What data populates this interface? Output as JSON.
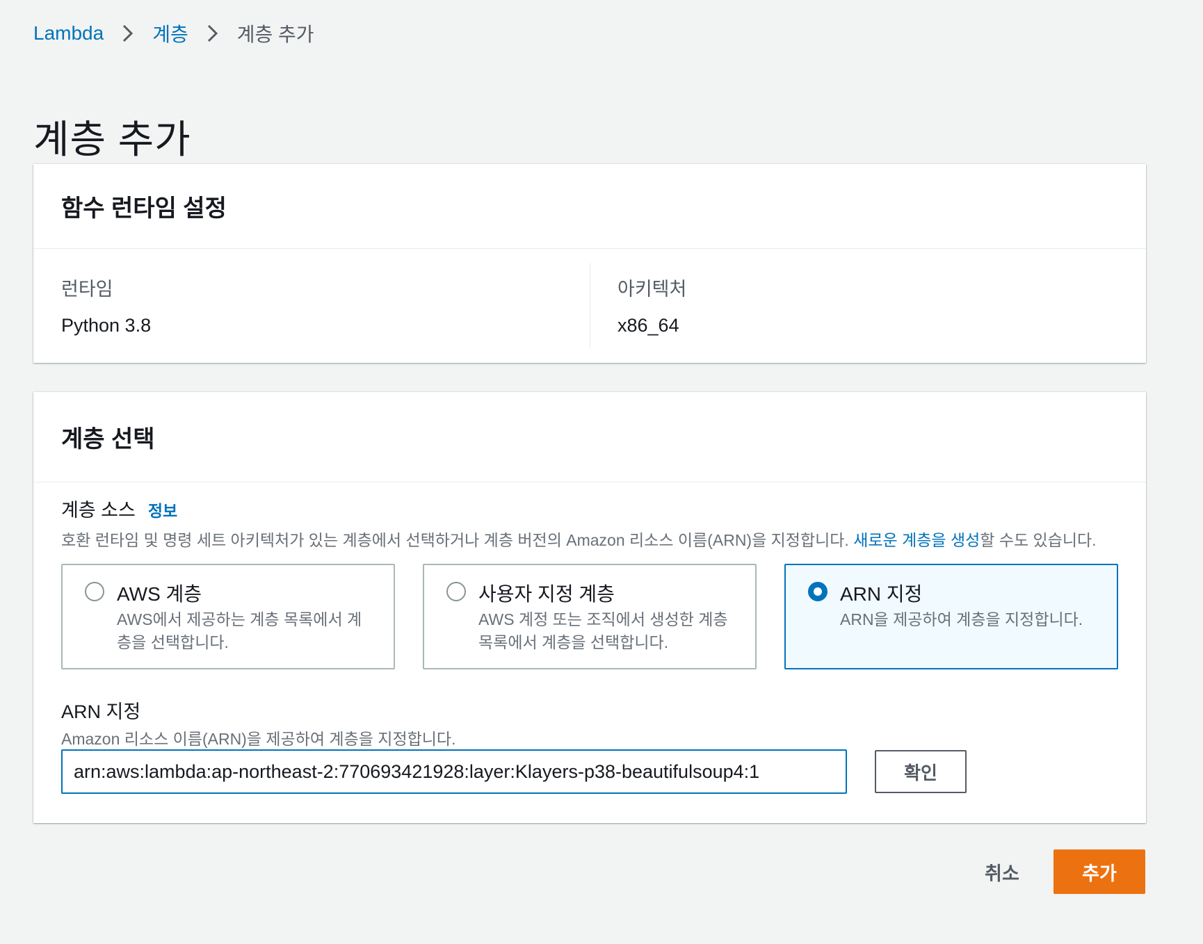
{
  "breadcrumb": {
    "items": [
      "Lambda",
      "계층",
      "계층 추가"
    ]
  },
  "page_title": "계층 추가",
  "runtime_panel": {
    "title": "함수 런타임 설정",
    "runtime": {
      "label": "런타임",
      "value": "Python 3.8"
    },
    "architecture": {
      "label": "아키텍처",
      "value": "x86_64"
    }
  },
  "layer_panel": {
    "title": "계층 선택",
    "source": {
      "label": "계층 소스",
      "info": "정보",
      "description_before": "호환 런타임 및 명령 세트 아키텍처가 있는 계층에서 선택하거나 계층 버전의 Amazon 리소스 이름(ARN)을 지정합니다. ",
      "description_link": "새로운 계층을 생성",
      "description_after": "할 수도 있습니다."
    },
    "options": [
      {
        "title": "AWS 계층",
        "desc": "AWS에서 제공하는 계층 목록에서 계층을 선택합니다.",
        "selected": false
      },
      {
        "title": "사용자 지정 계층",
        "desc": "AWS 계정 또는 조직에서 생성한 계층 목록에서 계층을 선택합니다.",
        "selected": false
      },
      {
        "title": "ARN 지정",
        "desc": "ARN을 제공하여 계층을 지정합니다.",
        "selected": true
      }
    ],
    "arn": {
      "label": "ARN 지정",
      "description": "Amazon 리소스 이름(ARN)을 제공하여 계층을 지정합니다.",
      "value": "arn:aws:lambda:ap-northeast-2:770693421928:layer:Klayers-p38-beautifulsoup4:1",
      "confirm_label": "확인"
    }
  },
  "footer": {
    "cancel_label": "취소",
    "add_label": "추가"
  },
  "colors": {
    "link": "#0073bb",
    "primary": "#ec7211",
    "selected_bg": "#f1faff",
    "background": "#f2f3f3"
  }
}
